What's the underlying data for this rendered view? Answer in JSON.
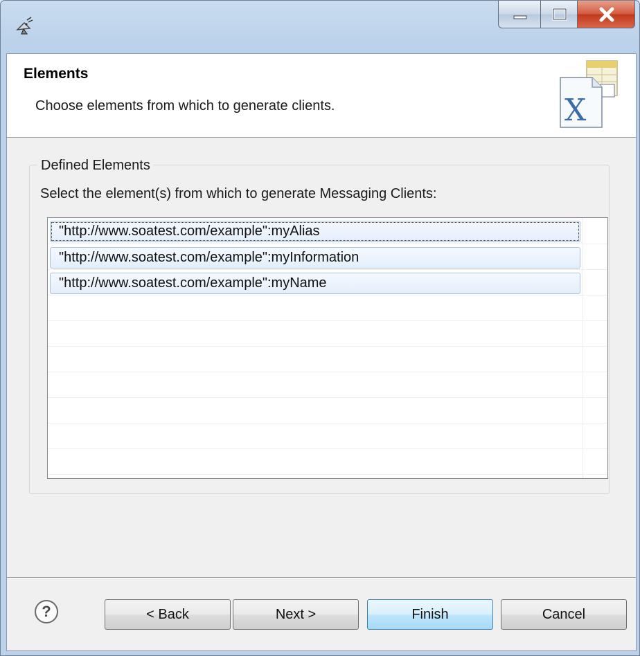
{
  "window": {
    "controls": [
      "minimize-icon",
      "maximize-icon",
      "close-icon"
    ]
  },
  "banner": {
    "title": "Elements",
    "description": "Choose elements from which to generate clients."
  },
  "group": {
    "legend": "Defined Elements",
    "instruction": "Select the element(s) from which to generate Messaging Clients:",
    "items": [
      {
        "label": "\"http://www.soatest.com/example\":myAlias"
      },
      {
        "label": "\"http://www.soatest.com/example\":myInformation"
      },
      {
        "label": "\"http://www.soatest.com/example\":myName"
      }
    ]
  },
  "footer": {
    "help": "?",
    "back_label": "< Back",
    "next_label": "Next >",
    "finish_label": "Finish",
    "cancel_label": "Cancel"
  },
  "colors": {
    "accent": "#3c7fb1",
    "close": "#c0391c",
    "selection": "#e4eefb"
  }
}
